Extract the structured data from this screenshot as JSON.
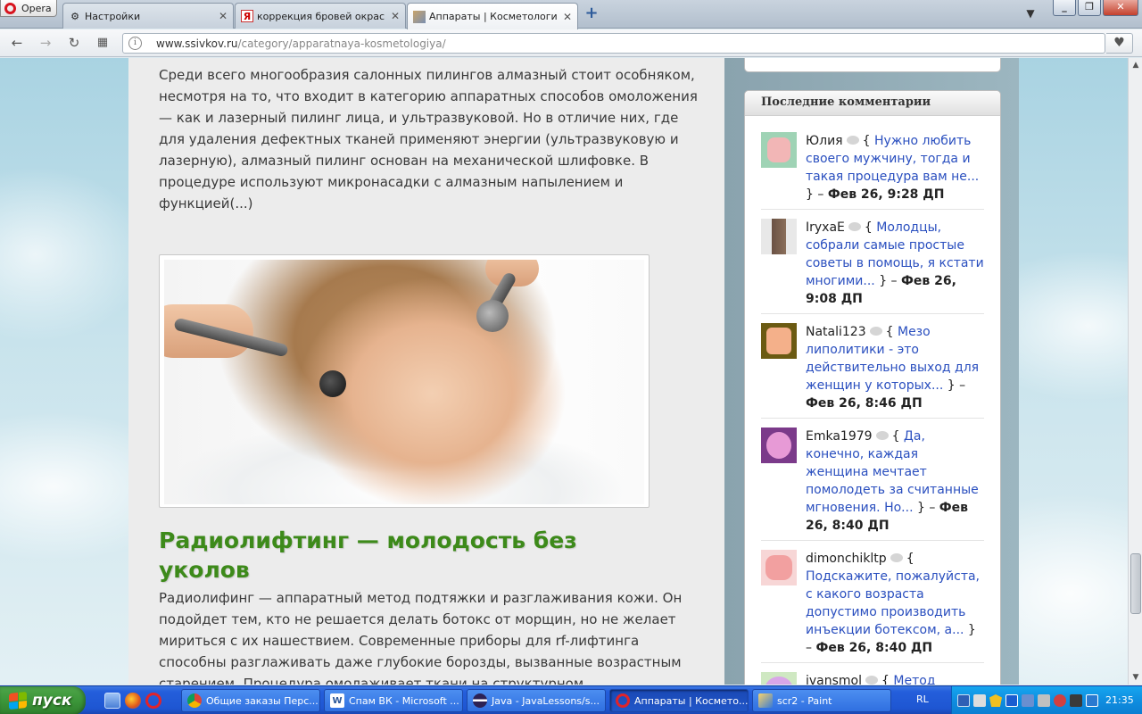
{
  "browser": {
    "menu_label": "Opera",
    "tabs": [
      {
        "title": "Настройки",
        "icon": "gear-icon"
      },
      {
        "title": "коррекция бровей окраска",
        "icon": "yandex-icon"
      },
      {
        "title": "Аппараты | Косметология",
        "icon": "site-favicon"
      }
    ],
    "url_host": "www.ssivkov.ru",
    "url_path": "/category/apparatnaya-kosmetologiya/"
  },
  "article": {
    "intro_text": "Среди всего многообразия салонных пилингов алмазный стоит особняком, несмотря на то, что входит в категорию аппаратных способов омоложения — как и лазерный пилинг лица, и ультразвуковой. Но в отличие них, где для удаления дефектных тканей применяют энергии (ультразвуковую и лазерную), алмазный пилинг основан на механической шлифовке. В процедуре используют микронасадки с алмазным напылением и функцией(...)",
    "post_title": "Радиолифтинг — молодость без уколов",
    "post_text": "Радиолифинг — аппаратный метод подтяжки и разглаживания кожи. Он подойдет тем, кто не решается делать ботокс от морщин, но не желает мириться с их нашествием. Современные приборы для rf-лифтинга способны разглаживать даже глубокие борозды, вызванные возрастным старением. Процедура омолаживает ткани на структурном"
  },
  "sidebar": {
    "widget_title": "Последние комментарии",
    "comments": [
      {
        "author": "Юлия",
        "quote": "Нужно любить своего мужчину, тогда и такая процедура вам не...",
        "date": "Фев 26, 9:28 ДП",
        "avatar_color": "#f2b6b6"
      },
      {
        "author": "IryxaE",
        "quote": "Молодцы, собрали самые простые советы в помощь, я кстати многими...",
        "date": "Фев 26, 9:08 ДП",
        "avatar_color": "#6a5244"
      },
      {
        "author": "Natali123",
        "quote": "Мезо липолитики - это действительно выход для женщин у которых...",
        "date": "Фев 26, 8:46 ДП",
        "avatar_color": "#f4b08a"
      },
      {
        "author": "Emka1979",
        "quote": "Да, конечно, каждая женщина мечтает помолодеть за считанные мгновения. Но...",
        "date": "Фев 26, 8:40 ДП",
        "avatar_color": "#e79ad6"
      },
      {
        "author": "dimonchikltp",
        "quote": "Подскажите, пожалуйста, с какого возраста допустимо производить инъекции ботексом, а...",
        "date": "Фев 26, 8:40 ДП",
        "avatar_color": "#f2a0a0"
      },
      {
        "author": "ivansmol",
        "quote": "Метод действенный и из всех современных технологий",
        "date": "",
        "avatar_color": "#d9a6e8"
      }
    ]
  },
  "taskbar": {
    "start_label": "пуск",
    "tasks": [
      {
        "title": "Общие заказы Перс...",
        "icon": "chrome-icon"
      },
      {
        "title": "Спам ВК - Microsoft ...",
        "icon": "word-icon"
      },
      {
        "title": "Java - JavaLessons/s...",
        "icon": "eclipse-icon"
      },
      {
        "title": "Аппараты | Космето...",
        "icon": "opera-icon"
      },
      {
        "title": "scr2 - Paint",
        "icon": "paint-icon"
      }
    ],
    "language": "RL",
    "clock": "21:35"
  }
}
